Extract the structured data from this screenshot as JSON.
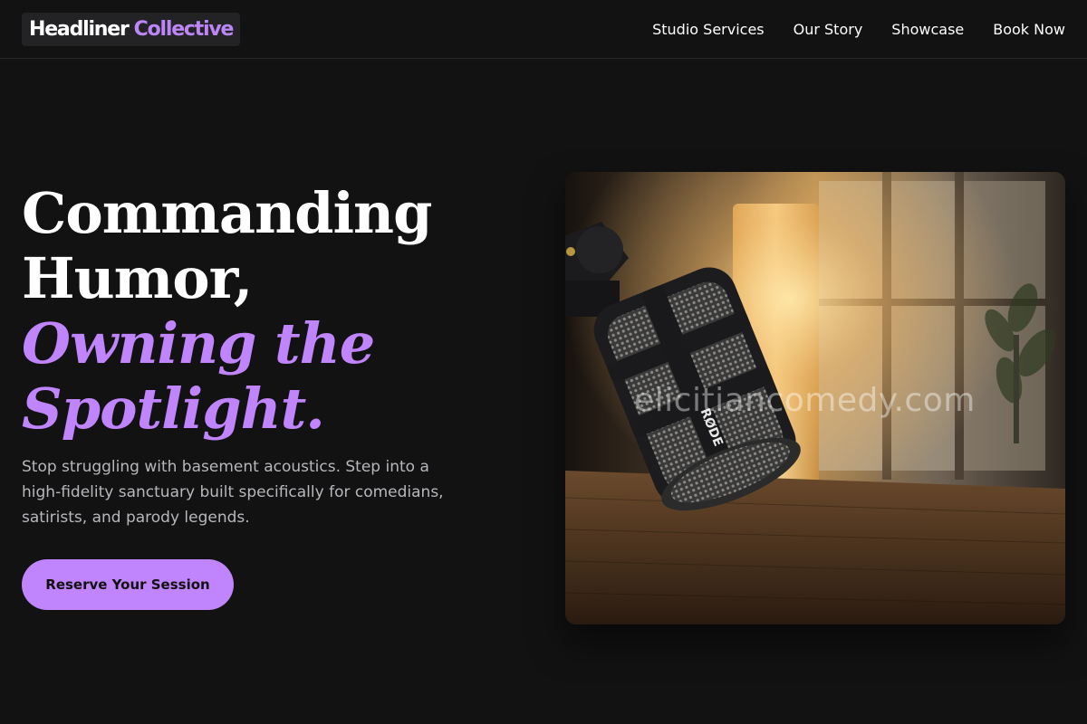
{
  "brand": {
    "word1": "Headliner",
    "word2": "Collective"
  },
  "nav": {
    "items": [
      {
        "label": "Studio Services"
      },
      {
        "label": "Our Story"
      },
      {
        "label": "Showcase"
      },
      {
        "label": "Book Now"
      }
    ]
  },
  "hero": {
    "headline_line1": "Commanding",
    "headline_line2": "Humor,",
    "headline_accent1": "Owning the",
    "headline_accent2": "Spotlight.",
    "subtext": "Stop struggling with basement acoustics. Step into a high-fidelity sanctuary built specifically for comedians, satirists, and parody legends.",
    "cta_label": "Reserve Your Session"
  },
  "image": {
    "subject": "podcast-microphone",
    "mic_brand": "RØDE",
    "watermark": "elicitiancomedy.com"
  },
  "colors": {
    "background": "#121213",
    "accent": "#c084fc",
    "text": "#ffffff",
    "muted": "#b7b7bc"
  }
}
